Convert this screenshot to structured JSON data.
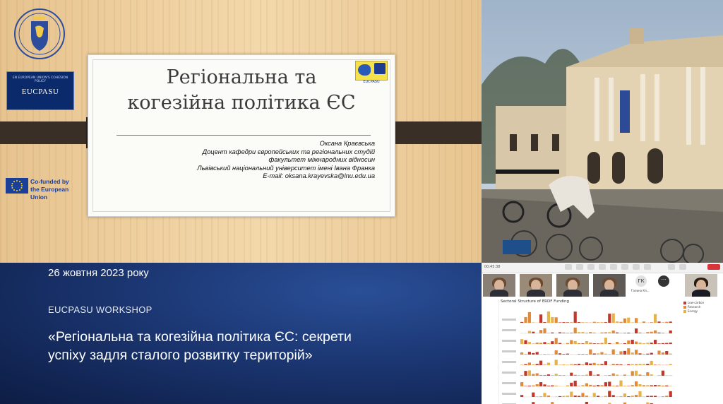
{
  "slide": {
    "title_line1": "Регіональна та",
    "title_line2": "когезійна політика ЄС",
    "author": "Оксана Краєвська",
    "position_line1": "Доцент кафедри європейських та регіональних студій",
    "position_line2": "факультет міжнародних відносин",
    "university": "Львівський національний університет імені Івана Франка",
    "email": "E-mail: oksana.krayevska@lnu.edu.ua"
  },
  "logos": {
    "eucpasu_small": "EN EUROPEAN UNION'S COHESION POLICY",
    "eucpasu_label": "EUCPASU",
    "eu_line1": "Co-funded by",
    "eu_line2": "the European Union",
    "mini_caption": "EUCPASU"
  },
  "banner": {
    "date": "26 жовтня 2023 року",
    "workshop": "EUCPASU WORKSHOP",
    "headline_line1": "«Регіональна та когезійна політика ЄС: секрети",
    "headline_line2": "успіху задля сталого розвитку територій»"
  },
  "zoom": {
    "time": "00:45:38",
    "gk_initials": "ГК",
    "more": "···",
    "gk_name": "Галина Кл...",
    "chart_title": "Sectoral Structure of ERDF Funding",
    "legend": [
      {
        "label": "Low-carbon",
        "color": "#c0392b"
      },
      {
        "label": "Research",
        "color": "#e08a3c"
      },
      {
        "label": "Energy",
        "color": "#e6b24a"
      }
    ]
  },
  "colors": {
    "banner_bg": "#1b3672",
    "wood": "#f0d2a2",
    "slide_rule": "#7a8c3a"
  }
}
